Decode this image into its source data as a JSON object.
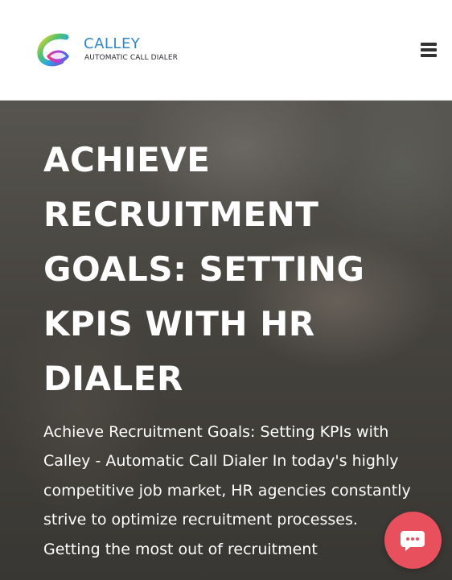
{
  "header": {
    "logo": {
      "name": "CALLEY",
      "tagline": "AUTOMATIC CALL DIALER"
    },
    "menu_icon": "hamburger-menu-icon"
  },
  "hero": {
    "title": "ACHIEVE RECRUITMENT GOALS: SETTING KPIS WITH HR DIALER",
    "excerpt": "Achieve Recruitment Goals: Setting KPIs with Calley - Automatic Call Dialer In today's highly competitive job market, HR agencies constantly strive to optimize recruitment processes. Getting the most out of recruitment"
  },
  "chat": {
    "icon": "chat-bubble-icon",
    "color": "#e8505e"
  },
  "colors": {
    "brand_blue": "#2f86c9",
    "header_bg": "#ffffff",
    "hero_text": "#ffffff"
  }
}
